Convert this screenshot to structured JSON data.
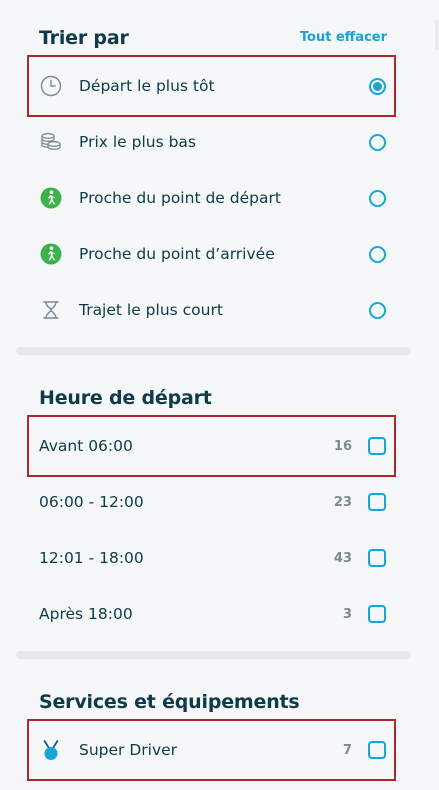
{
  "sort": {
    "title": "Trier par",
    "clear_label": "Tout effacer",
    "options": [
      {
        "label": "Départ le plus tôt",
        "icon": "clock-icon",
        "selected": true
      },
      {
        "label": "Prix le plus bas",
        "icon": "coins-icon",
        "selected": false
      },
      {
        "label": "Proche du point de départ",
        "icon": "walking-person-icon",
        "selected": false
      },
      {
        "label": "Proche du point d’arrivée",
        "icon": "walking-person-icon",
        "selected": false
      },
      {
        "label": "Trajet le plus court",
        "icon": "hourglass-icon",
        "selected": false
      }
    ]
  },
  "departure": {
    "title": "Heure de départ",
    "options": [
      {
        "label": "Avant 06:00",
        "count": "16",
        "checked": false
      },
      {
        "label": "06:00 - 12:00",
        "count": "23",
        "checked": false
      },
      {
        "label": "12:01 - 18:00",
        "count": "43",
        "checked": false
      },
      {
        "label": "Après 18:00",
        "count": "3",
        "checked": false
      }
    ]
  },
  "services": {
    "title": "Services et équipements",
    "options": [
      {
        "label": "Super Driver",
        "count": "7",
        "icon": "medal-icon",
        "checked": false
      }
    ]
  },
  "colors": {
    "accent": "#16a4d9",
    "text": "#0d3b4a",
    "highlight": "#b3262e",
    "walker_green": "#3eb24a"
  }
}
